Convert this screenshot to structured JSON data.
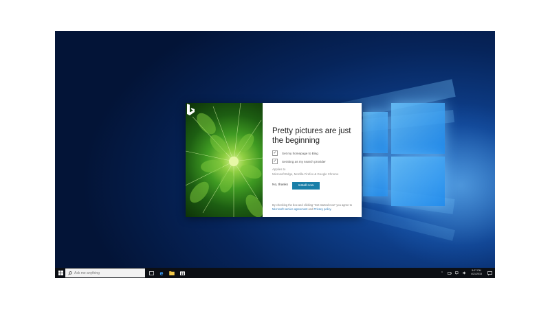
{
  "dialog": {
    "title": "Pretty pictures are just the beginning",
    "options": [
      {
        "label": "Set my homepage to Bing",
        "checked": true
      },
      {
        "label": "Set Bing as my search provider",
        "checked": true
      }
    ],
    "applies_to_heading": "Applies to",
    "applies_to_value": "Microsoft Edge, Mozilla Firefox & Google Chrome",
    "no_thanks_label": "No, thanks",
    "install_label": "Install now",
    "fineprint_prefix": "By checking the box and clicking \"Get started now\" you agree to ",
    "agreement_link": "Microsoft service agreement",
    "and_text": " and ",
    "privacy_link": "Privacy policy",
    "end_text": ".",
    "brand_mark_icon": "bing-logo-icon",
    "accent_color": "#1a7fa8"
  },
  "taskbar": {
    "search_placeholder": "Ask me anything",
    "apps": [
      "task-view-icon",
      "edge-icon",
      "file-explorer-icon",
      "store-icon"
    ],
    "clock_time": "5:07 PM",
    "clock_date": "4/21/2015"
  }
}
